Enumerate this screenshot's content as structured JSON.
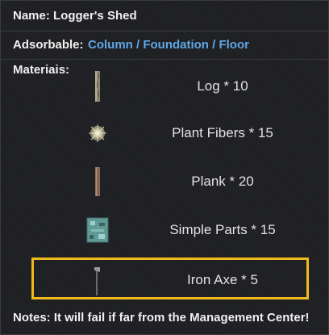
{
  "header": {
    "name_label": "Name:",
    "name_value": "Logger's Shed",
    "adsorbable_label": "Adsorbable:",
    "adsorbable_value": "Column / Foundation / Floor"
  },
  "materials_label": "Materiais:",
  "materials": [
    {
      "label": "Log * 10",
      "icon": "log-icon"
    },
    {
      "label": "Plant Fibers * 15",
      "icon": "plant-fibers-icon"
    },
    {
      "label": "Plank * 20",
      "icon": "plank-icon"
    },
    {
      "label": "Simple Parts * 15",
      "icon": "simple-parts-icon"
    },
    {
      "label": "Iron Axe * 5",
      "icon": "iron-axe-icon"
    }
  ],
  "notes": "Notes:  It will fail if far from the Management Center!",
  "colors": {
    "accent_blue": "#5fa7e6",
    "highlight_yellow": "#f2b91e",
    "background": "#1f2023"
  }
}
